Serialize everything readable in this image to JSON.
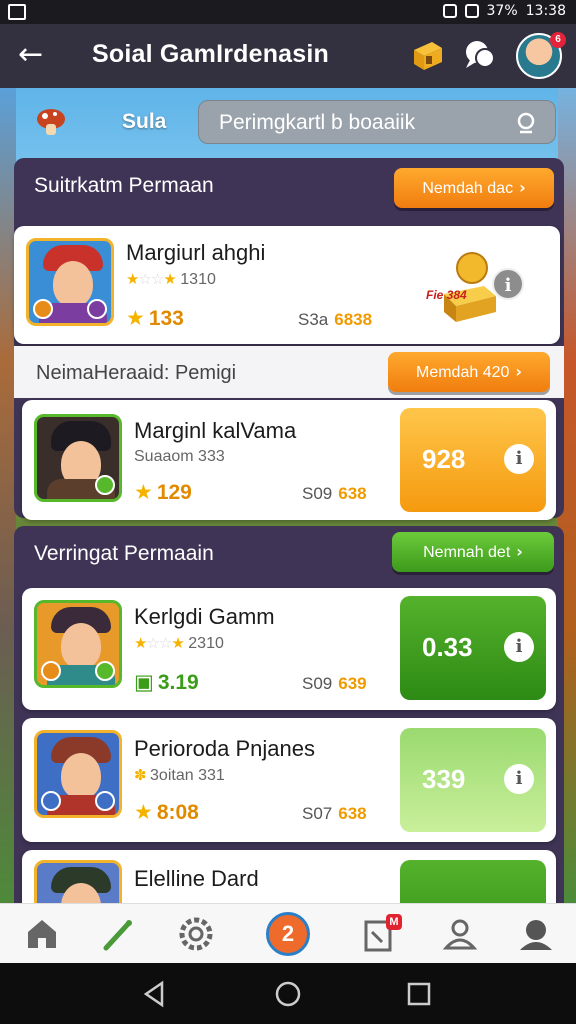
{
  "status_bar": {
    "battery": "37%",
    "time": "13:38"
  },
  "app_bar": {
    "title": "Soial GamIrdenasin",
    "avatar_badge": "6"
  },
  "search": {
    "label": "Sula",
    "placeholder": "Perimgkartl b boaaiik"
  },
  "section1": {
    "title": "Suitrkatm Permaan",
    "button": "Nemdah dac"
  },
  "card1": {
    "name": "Margiurl ahghi",
    "stars_text": "1310",
    "rating": "133",
    "price_label": "S3a",
    "price_coin": "6838",
    "chest_label": "Fie 384"
  },
  "subheader": {
    "label": "NeimaHeraaid: Pemigi",
    "button": "Memdah 420"
  },
  "card2": {
    "name": "Marginl kalVama",
    "sub": "Suaaom 333",
    "rating": "129",
    "price_label": "S09",
    "price_coin": "638",
    "action_value": "928"
  },
  "section2": {
    "title": "Verringat Permaain",
    "button": "Nemnah det"
  },
  "card3": {
    "name": "Kerlgdi Gamm",
    "stars_text": "2310",
    "rating": "3.19",
    "price_label": "S09",
    "price_coin": "639",
    "action_value": "0.33"
  },
  "card4": {
    "name": "Perioroda Pnjanes",
    "sub": "3oitan 331",
    "rating": "8:08",
    "price_label": "S07",
    "price_coin": "638",
    "action_value": "339"
  },
  "card5": {
    "name": "Elelline Dard"
  },
  "bottom_nav": {
    "center_label": "2",
    "badge": "M"
  },
  "colors": {
    "accent_orange": "#f07d0f",
    "accent_green": "#3d9a1c",
    "panel": "#3f3456",
    "appbar": "#33303f"
  },
  "icons": [
    "back-arrow-icon",
    "gift-box-icon",
    "chat-icon",
    "search-icon",
    "home-icon",
    "pen-icon",
    "settings-icon",
    "notes-icon",
    "user-icon",
    "profile-icon"
  ]
}
